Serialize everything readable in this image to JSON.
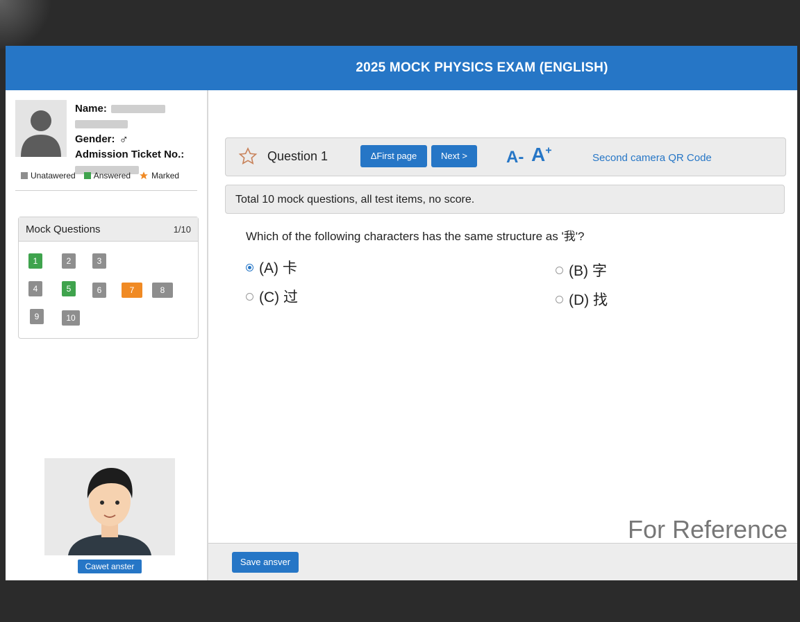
{
  "header": {
    "title": "2025 MOCK PHYSICS EXAM (ENGLISH)"
  },
  "candidate": {
    "name_label": "Name:",
    "gender_label": "Gender:",
    "gender_symbol": "♂",
    "ticket_label": "Admission Ticket No.:"
  },
  "legend": [
    {
      "label": "Unatawered",
      "color": "#8e8e8e",
      "icon": "gray-square-icon"
    },
    {
      "label": "Answered",
      "color": "#3fa34d",
      "icon": "green-square-icon"
    },
    {
      "label": "Marked",
      "color": "#f08a24",
      "icon": "star-icon"
    }
  ],
  "mock_panel": {
    "title": "Mock Questions",
    "count": "1/10",
    "questions": [
      {
        "num": "1",
        "status": "answered"
      },
      {
        "num": "2",
        "status": "unanswered"
      },
      {
        "num": "3",
        "status": "unanswered"
      },
      {
        "num": "4",
        "status": "unanswered"
      },
      {
        "num": "5",
        "status": "answered"
      },
      {
        "num": "6",
        "status": "unanswered"
      },
      {
        "num": "7",
        "status": "marked"
      },
      {
        "num": "8",
        "status": "unanswered"
      },
      {
        "num": "9",
        "status": "unanswered"
      },
      {
        "num": "10",
        "status": "unanswered"
      }
    ]
  },
  "camera_button": "Cawet anster",
  "question_bar": {
    "question_label": "Question 1",
    "first_page": "ΔFirst page",
    "next": "Next >",
    "font_decrease": "A-",
    "font_increase": "A",
    "font_increase_sup": "+",
    "qr_link": "Second camera QR Code"
  },
  "notice": "Total 10 mock questions, all test items, no score.",
  "question": {
    "text": "Which of the following characters has the same structure as '我'?",
    "options": [
      {
        "label": "(A) 卡",
        "selected": true
      },
      {
        "label": "(B) 字",
        "selected": false
      },
      {
        "label": "(C) 过",
        "selected": false
      },
      {
        "label": "(D) 找",
        "selected": false
      }
    ]
  },
  "watermark": "For Reference",
  "save_button": "Save ansver",
  "colors": {
    "accent": "#2676c6",
    "answered": "#3fa34d",
    "marked": "#f08a24",
    "unanswered": "#8e8e8e"
  }
}
